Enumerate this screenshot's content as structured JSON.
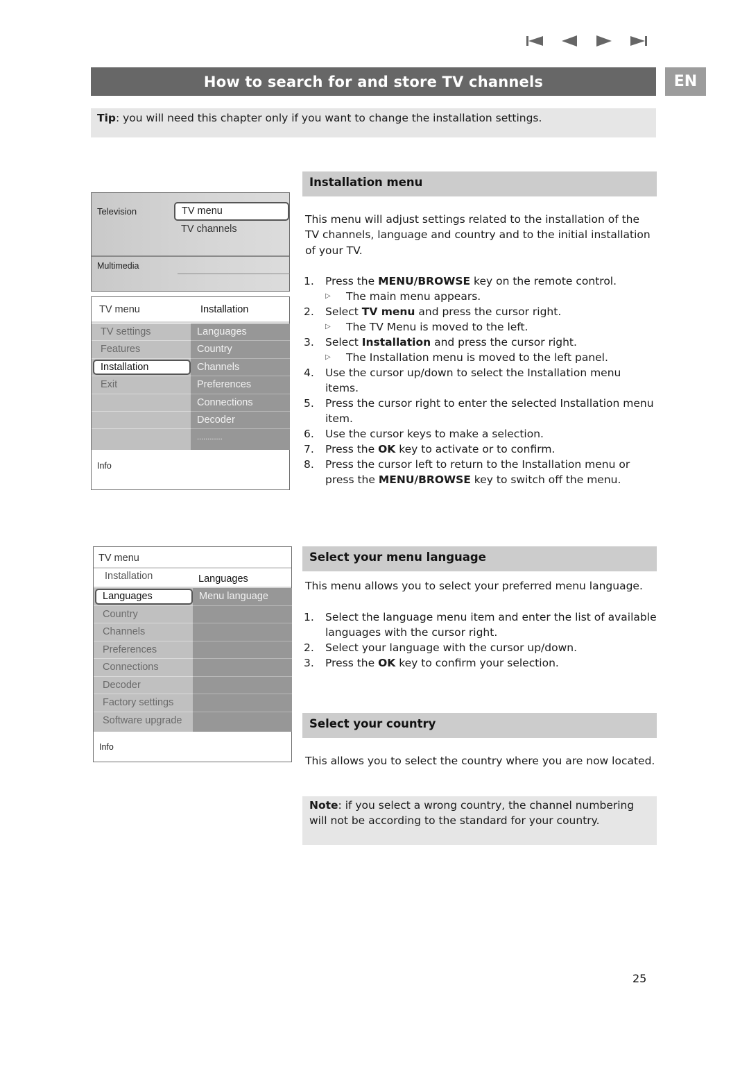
{
  "nav": {
    "icons": [
      "skip-to-first-icon",
      "previous-icon",
      "next-icon",
      "skip-to-last-icon"
    ]
  },
  "header": {
    "title": "How to search for and store TV channels",
    "language_badge": "EN"
  },
  "tip": {
    "label": "Tip",
    "text": ": you will need this chapter only if you want to change the installation settings."
  },
  "menu_main": {
    "television_label": "Television",
    "selected_item": "TV menu",
    "second_item": "TV channels",
    "multimedia_label": "Multimedia"
  },
  "menu_installation": {
    "header_left": "TV menu",
    "header_right": "Installation",
    "left_items": [
      "TV settings",
      "Features",
      "Installation",
      "Exit",
      "",
      "",
      ""
    ],
    "selected_index": 2,
    "right_items": [
      "Languages",
      "Country",
      "Channels",
      "Preferences",
      "Connections",
      "Decoder",
      "............"
    ],
    "info_label": "Info"
  },
  "menu_languages": {
    "header": "TV menu",
    "sub_left": "Installation",
    "sub_right": "Languages",
    "left_items": [
      "Languages",
      "Country",
      "Channels",
      "Preferences",
      "Connections",
      "Decoder",
      "Factory settings",
      "Software upgrade"
    ],
    "selected_index": 0,
    "right_items": [
      "Menu language",
      "",
      "",
      "",
      "",
      "",
      "",
      ""
    ],
    "info_label": "Info"
  },
  "installation_section": {
    "heading": "Installation menu",
    "intro": "This menu will adjust settings related to the installation of the TV channels, language and country and to the initial installation of your TV.",
    "steps": [
      {
        "num": "1.",
        "pre": "Press the ",
        "bold": "MENU/BROWSE",
        "post": " key on the remote control.",
        "sub": "The main menu appears."
      },
      {
        "num": "2.",
        "pre": "Select ",
        "bold": "TV menu",
        "post": " and press the cursor right.",
        "sub": "The TV Menu is moved to the left."
      },
      {
        "num": "3.",
        "pre": "Select ",
        "bold": "Installation",
        "post": " and press the cursor right.",
        "sub": "The Installation menu is moved to the left panel."
      },
      {
        "num": "4.",
        "pre": "Use the cursor up/down to select the Installation menu items.",
        "bold": "",
        "post": "",
        "sub": ""
      },
      {
        "num": "5.",
        "pre": "Press the cursor right to enter the selected Installation menu item.",
        "bold": "",
        "post": "",
        "sub": ""
      },
      {
        "num": "6.",
        "pre": "Use the cursor keys to make a selection.",
        "bold": "",
        "post": "",
        "sub": ""
      },
      {
        "num": "7.",
        "pre": "Press the ",
        "bold": "OK",
        "post": " key to activate or to confirm.",
        "sub": ""
      },
      {
        "num": "8.",
        "pre": "Press the cursor left to return to the Installation menu or press the ",
        "bold": "MENU/BROWSE",
        "post": " key to switch off the menu.",
        "sub": ""
      }
    ]
  },
  "language_section": {
    "heading": "Select your menu language",
    "intro": "This menu allows you to select your preferred menu language.",
    "steps": [
      {
        "num": "1.",
        "pre": "Select the language menu item and enter the list of available languages with the cursor right.",
        "bold": "",
        "post": "",
        "sub": ""
      },
      {
        "num": "2.",
        "pre": "Select your language with the cursor up/down.",
        "bold": "",
        "post": "",
        "sub": ""
      },
      {
        "num": "3.",
        "pre": "Press the ",
        "bold": "OK",
        "post": " key to confirm your selection.",
        "sub": ""
      }
    ]
  },
  "country_section": {
    "heading": "Select your country",
    "intro": "This allows you to select the country where you are now located.",
    "note_label": "Note",
    "note_text": ": if you select a wrong country, the channel numbering will not be according to the standard for your country."
  },
  "footer": {
    "page_number": "25"
  },
  "colors": {
    "title_bar": "#676767",
    "badge": "#9c9c9c",
    "tip_bg": "#e6e6e6",
    "section_head_bg": "#cccccc",
    "menu_left_col": "#c0c0c0",
    "menu_right_col": "#979797"
  }
}
